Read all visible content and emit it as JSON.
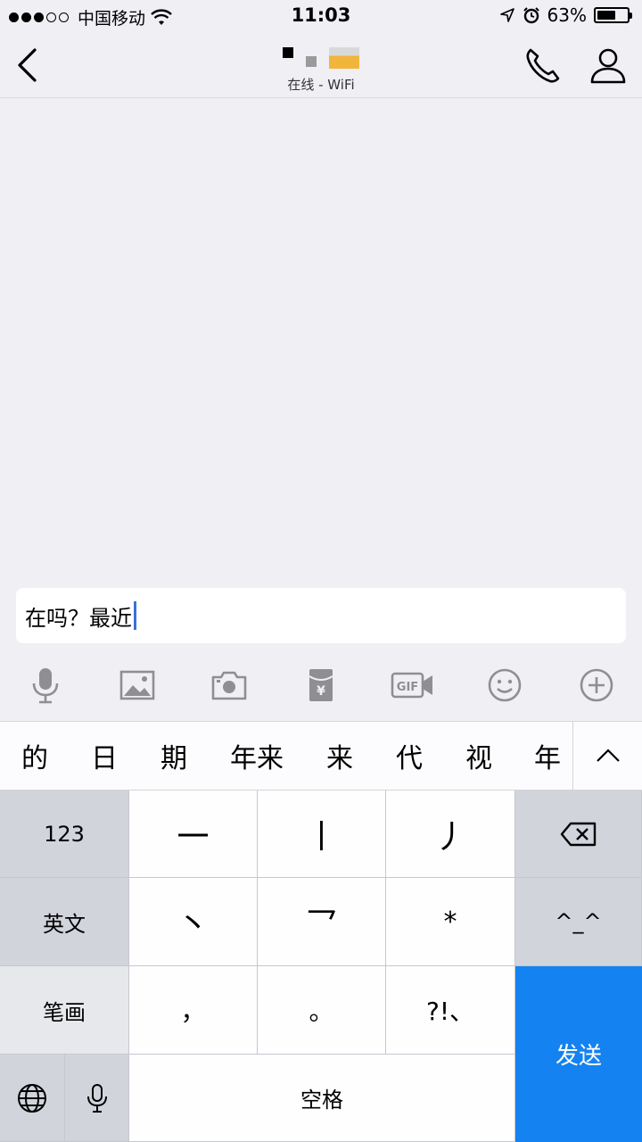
{
  "status_bar": {
    "carrier": "中国移动",
    "time": "11:03",
    "battery_percent": "63%",
    "battery_level": 0.63,
    "signal_bars_filled": 3,
    "signal_bars_total": 5
  },
  "nav": {
    "subtitle": "在线 - WiFi",
    "icons": [
      "chevron-left-icon",
      "phone-icon",
      "person-icon"
    ]
  },
  "input": {
    "value": "在吗？最近"
  },
  "toolbar": {
    "items": [
      "microphone-icon",
      "image-icon",
      "camera-icon",
      "red-envelope-icon",
      "gif-icon",
      "emoji-icon",
      "plus-icon"
    ],
    "red_envelope_symbol": "¥",
    "gif_label": "GIF"
  },
  "candidates": {
    "items": [
      "的",
      "日",
      "期",
      "年来",
      "来",
      "代",
      "视",
      "年"
    ]
  },
  "keyboard": {
    "row1": {
      "left": "123",
      "k1": "一",
      "k2": "丨",
      "k3": "丿"
    },
    "row2": {
      "left": "英文",
      "k1": "丶",
      "k2": "乛",
      "k3": "*",
      "right": "^_^"
    },
    "row3": {
      "left": "笔画",
      "k1": "，",
      "k2": "。",
      "k3": "?!、"
    },
    "row4": {
      "space": "空格"
    },
    "send": "发送",
    "accent": "#1482f0"
  }
}
